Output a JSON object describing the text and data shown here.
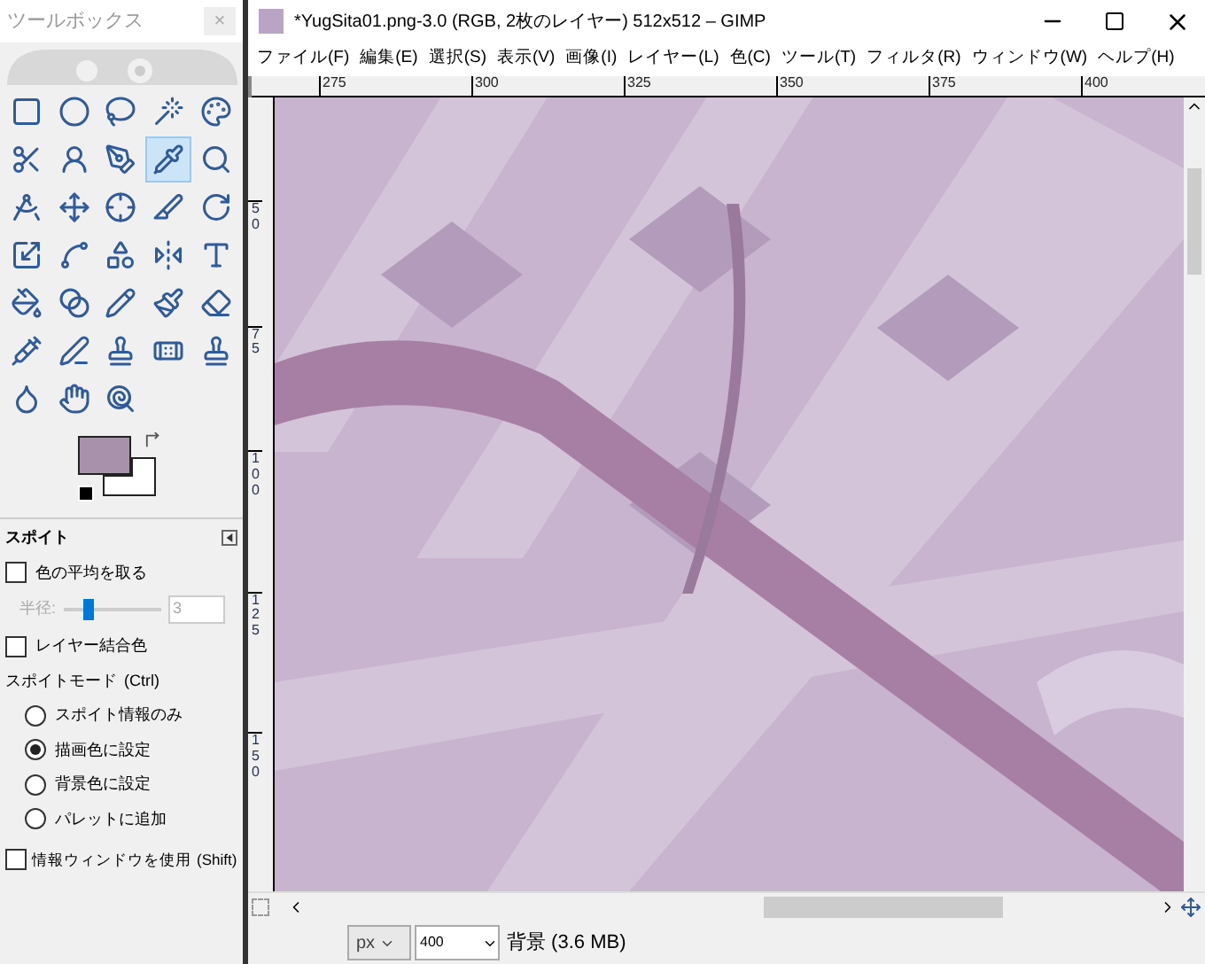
{
  "toolbox": {
    "title": "ツールボックス",
    "close": "×",
    "tools": [
      {
        "selected": false
      },
      {
        "selected": false
      },
      {
        "selected": false
      },
      {
        "selected": false
      },
      {
        "selected": false
      },
      {
        "selected": false
      },
      {
        "selected": false
      },
      {
        "selected": false
      },
      {
        "selected": true
      },
      {
        "selected": false
      },
      {
        "selected": false
      },
      {
        "selected": false
      },
      {
        "selected": false
      },
      {
        "selected": false
      },
      {
        "selected": false
      },
      {
        "selected": false
      },
      {
        "selected": false
      },
      {
        "selected": false
      },
      {
        "selected": false
      },
      {
        "selected": false
      },
      {
        "selected": false
      },
      {
        "selected": false
      },
      {
        "selected": false
      },
      {
        "selected": false
      },
      {
        "selected": false
      },
      {
        "selected": false
      },
      {
        "selected": false
      },
      {
        "selected": false
      },
      {
        "selected": false
      },
      {
        "selected": false
      },
      {
        "selected": false
      },
      {
        "selected": false
      },
      {
        "selected": false
      }
    ],
    "swatches": [
      {
        "kind": "foreground",
        "color": "#a892ab"
      },
      {
        "kind": "background",
        "color": "#ffffff"
      }
    ]
  },
  "tool_options": {
    "title": "スポイト",
    "average": {
      "label": "色の平均を取る",
      "checked": false
    },
    "radius": {
      "label": "半径:",
      "level": 0.2,
      "value": "3",
      "disabled": true
    },
    "merged": {
      "label": "レイヤー結合色",
      "checked": false
    },
    "mode_label": "スポイトモード",
    "mode_key": "(Ctrl)",
    "modes": [
      {
        "label": "スポイト情報のみ",
        "selected": false
      },
      {
        "label": "描画色に設定",
        "selected": true
      },
      {
        "label": "背景色に設定",
        "selected": false
      },
      {
        "label": "パレットに追加",
        "selected": false
      }
    ],
    "info_window": {
      "label": "情報ウィンドウを使用",
      "key": "(Shift)",
      "checked": false
    }
  },
  "window": {
    "title": "*YugSita01.png-3.0 (RGB, 2枚のレイヤー) 512x512 – GIMP",
    "menu": [
      "ファイル(F)",
      "編集(E)",
      "選択(S)",
      "表示(V)",
      "画像(I)",
      "レイヤー(L)",
      "色(C)",
      "ツール(T)",
      "フィルタ(R)",
      "ウィンドウ(W)",
      "ヘルプ(H)"
    ],
    "ruler_h": [
      "275",
      "300",
      "325",
      "350",
      "375",
      "400"
    ],
    "ruler_v": [
      "50",
      "75",
      "100",
      "125",
      "150"
    ],
    "status": {
      "unit": "px",
      "zoom": "400",
      "layer": "背景 (3.6 MB)"
    }
  }
}
